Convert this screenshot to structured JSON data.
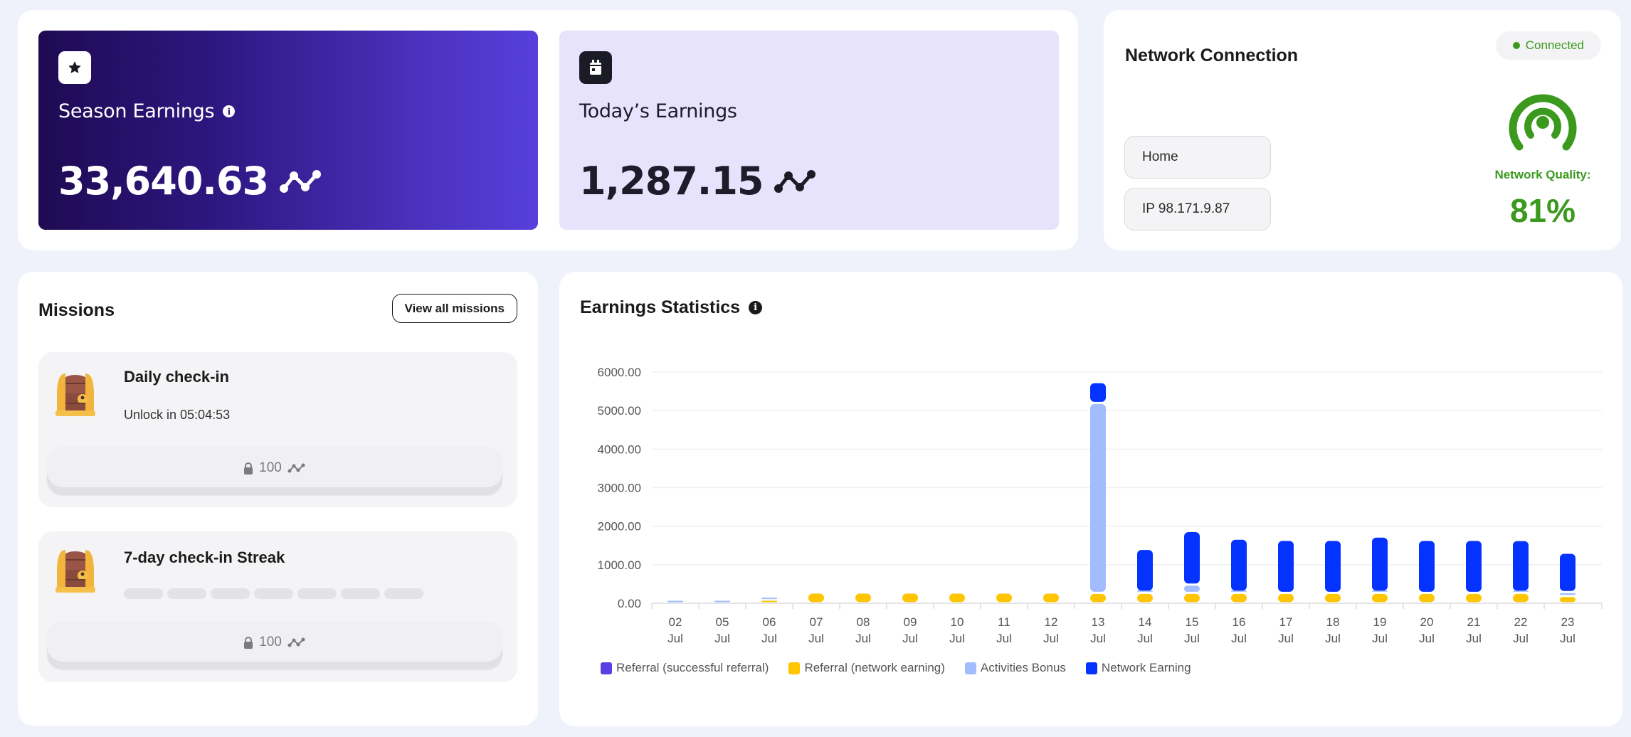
{
  "season_earnings": {
    "title": "Season Earnings",
    "value": "33,640.63",
    "icon": "star-icon",
    "info_icon": "info-icon",
    "token_icon": "points-token-icon"
  },
  "today_earnings": {
    "title": "Today’s Earnings",
    "value": "1,287.15",
    "icon": "calendar-icon",
    "token_icon": "points-token-icon"
  },
  "network": {
    "title": "Network Connection",
    "status": "Connected",
    "status_color": "#3b9a1e",
    "name": "Home",
    "ip": "IP 98.171.9.87",
    "quality_label": "Network Quality:",
    "quality_value": "81%",
    "quality_percent": 81
  },
  "missions": {
    "title": "Missions",
    "view_all_label": "View all missions",
    "items": [
      {
        "name": "Daily check-in",
        "subtitle": "Unlock in 05:04:53",
        "reward": "100",
        "locked": true
      },
      {
        "name": "7-day check-in Streak",
        "streak_days_total": 7,
        "streak_days_completed": 0,
        "reward": "100",
        "locked": true
      }
    ]
  },
  "chart_data": {
    "type": "bar",
    "stacked": true,
    "title": "Earnings Statistics",
    "xlabel": "",
    "ylabel": "",
    "ylim": [
      0,
      6000
    ],
    "yticks": [
      "0.00",
      "1000.00",
      "2000.00",
      "3000.00",
      "4000.00",
      "5000.00",
      "6000.00"
    ],
    "grid": true,
    "legend_position": "bottom-left",
    "categories": [
      [
        "02",
        "Jul"
      ],
      [
        "05",
        "Jul"
      ],
      [
        "06",
        "Jul"
      ],
      [
        "07",
        "Jul"
      ],
      [
        "08",
        "Jul"
      ],
      [
        "09",
        "Jul"
      ],
      [
        "10",
        "Jul"
      ],
      [
        "11",
        "Jul"
      ],
      [
        "12",
        "Jul"
      ],
      [
        "13",
        "Jul"
      ],
      [
        "14",
        "Jul"
      ],
      [
        "15",
        "Jul"
      ],
      [
        "16",
        "Jul"
      ],
      [
        "17",
        "Jul"
      ],
      [
        "18",
        "Jul"
      ],
      [
        "19",
        "Jul"
      ],
      [
        "20",
        "Jul"
      ],
      [
        "21",
        "Jul"
      ],
      [
        "22",
        "Jul"
      ],
      [
        "23",
        "Jul"
      ]
    ],
    "series": [
      {
        "name": "Referral (successful referral)",
        "color": "#5b3fe0",
        "values": [
          0,
          0,
          0,
          0,
          0,
          0,
          0,
          0,
          0,
          0,
          0,
          0,
          0,
          0,
          0,
          0,
          0,
          0,
          0,
          0
        ]
      },
      {
        "name": "Referral (network earning)",
        "color": "#ffc500",
        "values": [
          0,
          0,
          80,
          280,
          280,
          280,
          280,
          280,
          280,
          270,
          270,
          270,
          270,
          270,
          270,
          270,
          270,
          270,
          270,
          190
        ]
      },
      {
        "name": "Activities Bonus",
        "color": "#a3bcff",
        "values": [
          15,
          15,
          20,
          0,
          0,
          0,
          0,
          0,
          0,
          4930,
          30,
          215,
          30,
          0,
          0,
          30,
          0,
          0,
          30,
          100
        ]
      },
      {
        "name": "Network Earning",
        "color": "#0433ff",
        "values": [
          0,
          0,
          0,
          0,
          0,
          0,
          0,
          0,
          0,
          540,
          1110,
          1390,
          1375,
          1375,
          1375,
          1430,
          1375,
          1375,
          1340,
          1020
        ]
      }
    ]
  }
}
